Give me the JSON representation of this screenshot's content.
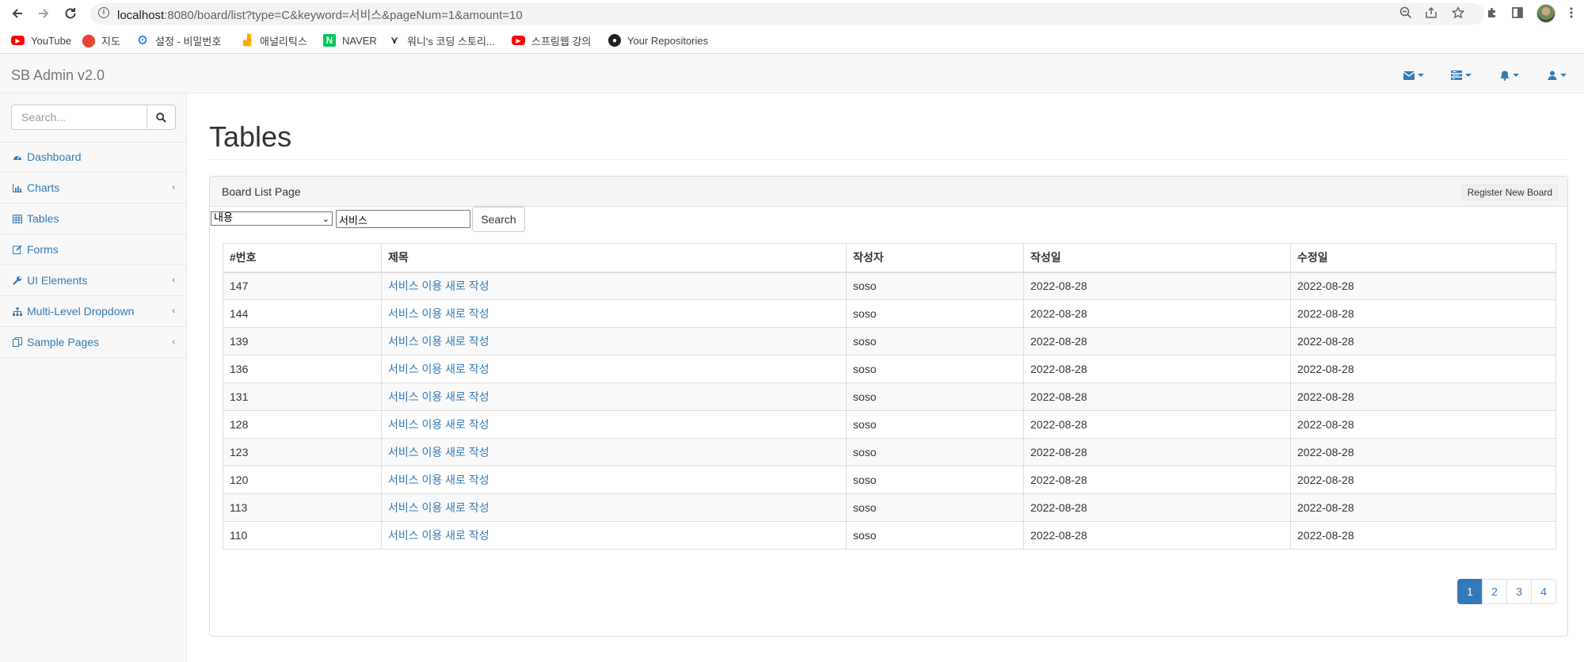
{
  "browser": {
    "url_host": "localhost",
    "url_rest": ":8080/board/list?type=C&keyword=서비스&pageNum=1&amount=10",
    "bookmarks": [
      {
        "label": "YouTube",
        "icon": "youtube-icon"
      },
      {
        "label": "지도",
        "icon": "maps-pin-icon"
      },
      {
        "label": "설정 - 비밀번호",
        "icon": "settings-gear-icon"
      },
      {
        "label": "애널리틱스",
        "icon": "analytics-icon"
      },
      {
        "label": "NAVER",
        "icon": "naver-icon"
      },
      {
        "label": "워니's 코딩 스토리...",
        "icon": "tree-icon"
      },
      {
        "label": "스프링웹 강의",
        "icon": "youtube-icon"
      },
      {
        "label": "Your Repositories",
        "icon": "github-icon"
      }
    ]
  },
  "navbar": {
    "brand": "SB Admin v2.0",
    "icons": [
      "envelope-icon",
      "tasks-icon",
      "bell-icon",
      "user-icon"
    ]
  },
  "sidebar": {
    "search_placeholder": "Search...",
    "items": [
      {
        "label": "Dashboard",
        "icon": "dashboard-icon",
        "has_arrow": false
      },
      {
        "label": "Charts",
        "icon": "bar-chart-icon",
        "has_arrow": true
      },
      {
        "label": "Tables",
        "icon": "table-icon",
        "has_arrow": false
      },
      {
        "label": "Forms",
        "icon": "edit-icon",
        "has_arrow": false
      },
      {
        "label": "UI Elements",
        "icon": "wrench-icon",
        "has_arrow": true
      },
      {
        "label": "Multi-Level Dropdown",
        "icon": "sitemap-icon",
        "has_arrow": true
      },
      {
        "label": "Sample Pages",
        "icon": "files-icon",
        "has_arrow": true
      }
    ]
  },
  "page": {
    "title": "Tables"
  },
  "panel": {
    "title": "Board List Page",
    "register_label": "Register New Board",
    "search": {
      "type_selected": "내용",
      "keyword": "서비스",
      "button_label": "Search"
    },
    "table": {
      "headers": [
        "#번호",
        "제목",
        "작성자",
        "작성일",
        "수정일"
      ],
      "rows": [
        {
          "bno": "147",
          "title": "서비스 이용 새로 작성",
          "writer": "soso",
          "regdate": "2022-08-28",
          "updatedate": "2022-08-28"
        },
        {
          "bno": "144",
          "title": "서비스 이용 새로 작성",
          "writer": "soso",
          "regdate": "2022-08-28",
          "updatedate": "2022-08-28"
        },
        {
          "bno": "139",
          "title": "서비스 이용 새로 작성",
          "writer": "soso",
          "regdate": "2022-08-28",
          "updatedate": "2022-08-28"
        },
        {
          "bno": "136",
          "title": "서비스 이용 새로 작성",
          "writer": "soso",
          "regdate": "2022-08-28",
          "updatedate": "2022-08-28"
        },
        {
          "bno": "131",
          "title": "서비스 이용 새로 작성",
          "writer": "soso",
          "regdate": "2022-08-28",
          "updatedate": "2022-08-28"
        },
        {
          "bno": "128",
          "title": "서비스 이용 새로 작성",
          "writer": "soso",
          "regdate": "2022-08-28",
          "updatedate": "2022-08-28"
        },
        {
          "bno": "123",
          "title": "서비스 이용 새로 작성",
          "writer": "soso",
          "regdate": "2022-08-28",
          "updatedate": "2022-08-28"
        },
        {
          "bno": "120",
          "title": "서비스 이용 새로 작성",
          "writer": "soso",
          "regdate": "2022-08-28",
          "updatedate": "2022-08-28"
        },
        {
          "bno": "113",
          "title": "서비스 이용 새로 작성",
          "writer": "soso",
          "regdate": "2022-08-28",
          "updatedate": "2022-08-28"
        },
        {
          "bno": "110",
          "title": "서비스 이용 새로 작성",
          "writer": "soso",
          "regdate": "2022-08-28",
          "updatedate": "2022-08-28"
        }
      ]
    },
    "pagination": {
      "pages": [
        "1",
        "2",
        "3",
        "4"
      ],
      "active": "1"
    }
  },
  "colors": {
    "link": "#337ab7",
    "active_page_bg": "#337ab7"
  }
}
